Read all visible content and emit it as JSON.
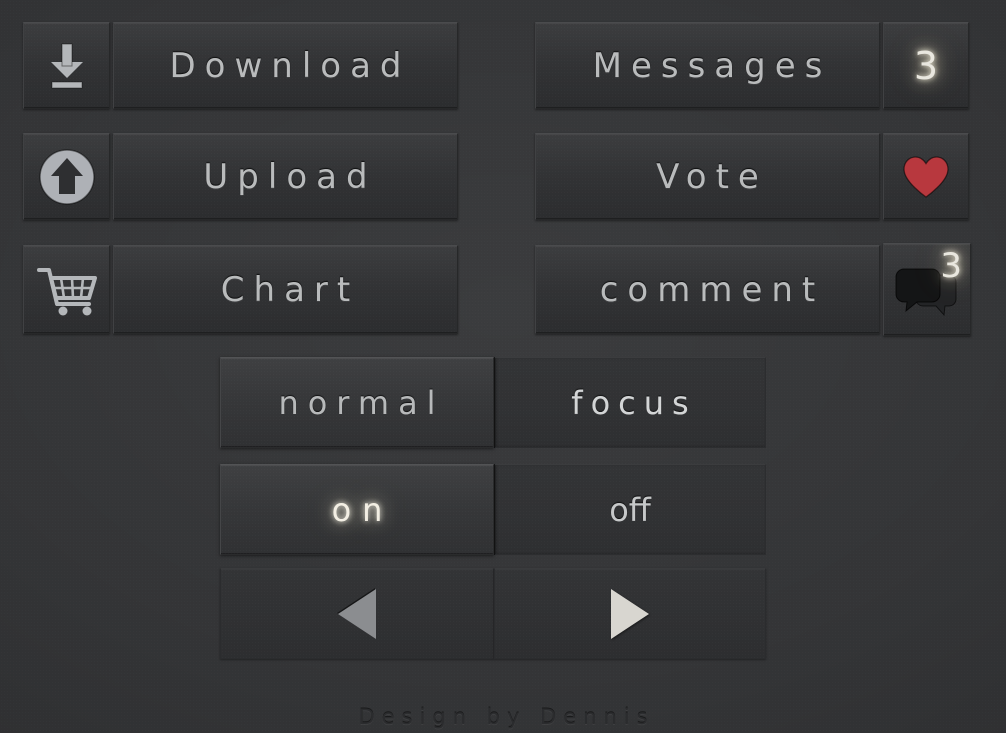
{
  "meta": {
    "background_color": "#343537",
    "panel_color": "#343537",
    "text_color": "#b9bbbc",
    "glow_color": "#fff6d8",
    "heart_color": "#b8383e"
  },
  "rows": [
    {
      "id": "download",
      "icon": "download-arrow-icon",
      "label": "Download"
    },
    {
      "id": "upload",
      "icon": "upload-circle-arrow-icon",
      "label": "Upload"
    },
    {
      "id": "chart",
      "icon": "shopping-cart-icon",
      "label": "Chart"
    }
  ],
  "rows_right": [
    {
      "id": "messages",
      "label": "Messages",
      "badge": "3",
      "badge_type": "number"
    },
    {
      "id": "vote",
      "label": "Vote",
      "badge": "",
      "badge_type": "heart"
    },
    {
      "id": "comment",
      "label": "comment",
      "badge": "3",
      "badge_type": "bubble"
    }
  ],
  "segments": {
    "state_row": {
      "left_label": "normal",
      "right_label": "focus",
      "selected": "normal"
    },
    "toggle_row": {
      "left_label": "on",
      "right_label": "off",
      "selected": "on"
    },
    "nav_row": {
      "left_icon": "arrow-left-icon",
      "right_icon": "arrow-right-icon"
    }
  },
  "footer": {
    "credit": "Design by Dennis"
  }
}
